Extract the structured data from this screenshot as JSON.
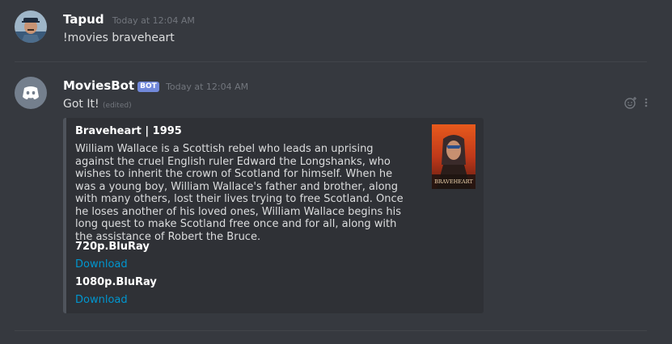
{
  "messages": [
    {
      "author": "Tapud",
      "timestamp": "Today at 12:04 AM",
      "text": "!movies braveheart"
    },
    {
      "author": "MoviesBot",
      "bot_tag": "BOT",
      "timestamp": "Today at 12:04 AM",
      "text": "Got It!",
      "edited_label": "(edited)",
      "embed": {
        "title": "Braveheart | 1995",
        "description": "William Wallace is a Scottish rebel who leads an uprising against the cruel English ruler Edward the Longshanks, who wishes to inherit the crown of Scotland for himself. When he was a young boy, William Wallace's father and brother, along with many others, lost their lives trying to free Scotland. Once he loses another of his loved ones, William Wallace begins his long quest to make Scotland free once and for all, along with the assistance of Robert the Bruce.",
        "thumbnail_caption": "BRAVEHEART",
        "fields": [
          {
            "name": "720p.BluRay",
            "value": "Download"
          },
          {
            "name": "1080p.BluRay",
            "value": "Download"
          }
        ]
      }
    }
  ],
  "icons": {
    "add_reaction": "add-reaction-icon",
    "more": "more-options-icon"
  },
  "colors": {
    "background": "#36393f",
    "embed_background": "#2f3136",
    "link": "#0096cf",
    "bot_tag": "#7289da"
  }
}
